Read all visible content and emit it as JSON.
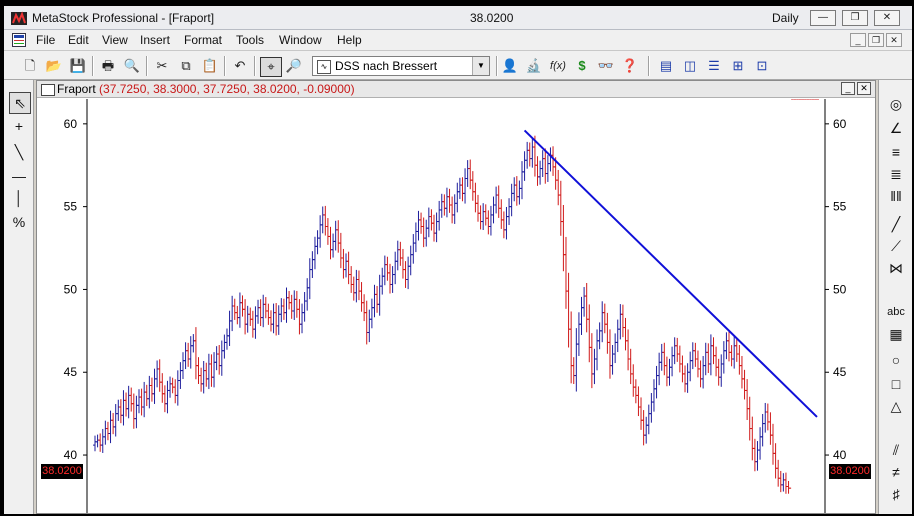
{
  "titlebar": {
    "app_title": "MetaStock Professional - [Fraport]",
    "center_value": "38.0200",
    "period": "Daily",
    "minimize": "—",
    "restore": "❐",
    "close": "✕"
  },
  "menu": {
    "items": [
      "File",
      "Edit",
      "View",
      "Insert",
      "Format",
      "Tools",
      "Window",
      "Help"
    ],
    "mdi_minimize": "_",
    "mdi_restore": "❐",
    "mdi_close": "✕"
  },
  "toolbar": {
    "indicator_selected": "DSS nach Bressert",
    "icons": {
      "new": "🗋",
      "open": "📂",
      "save": "💾",
      "print": "🖶",
      "print_preview": "🔍",
      "cut": "✂",
      "copy": "⧉",
      "paste": "📋",
      "undo": "↶",
      "crosshair": "⌖",
      "zoom": "🔎",
      "expert": "👤",
      "explorer": "🔬",
      "formula": "f(x)",
      "system": "$",
      "binoculars": "👓",
      "help": "❓",
      "win1": "▤",
      "win2": "◫",
      "win3": "☰",
      "win4": "⊞",
      "win5": "⊡"
    }
  },
  "left_tools": [
    "⇖",
    "+",
    "╲",
    "—",
    "│",
    "%"
  ],
  "right_tools": [
    "◎",
    "∠",
    "≡",
    "≣",
    "‖‖",
    "╱",
    "⟋",
    "⋈",
    "abc",
    "▦",
    "○",
    "□",
    "△",
    "⫽",
    "≠",
    "♯"
  ],
  "chart_window": {
    "caption_name": "Fraport",
    "caption_values": "(37.7250, 38.3000, 37.7250, 38.0200, -0.09000)",
    "btn_minimize": "_",
    "btn_close": "✕"
  },
  "colors": {
    "up_bar": "#1c1c9c",
    "down_bar": "#d01818",
    "trendline": "#1010d8",
    "axis_text": "#000000",
    "last_price_text": "#ff2a2a",
    "last_price_bg": "#000000"
  },
  "chart_data": {
    "type": "ohlc",
    "symbol": "Fraport",
    "y_ticks": [
      40,
      45,
      50,
      55,
      60
    ],
    "ylim": [
      36.5,
      61.5
    ],
    "last_price": "38.0200",
    "x": [
      1,
      2,
      3,
      4,
      5,
      6,
      7,
      8,
      9,
      10,
      11,
      12,
      13,
      14,
      15,
      16,
      17,
      18,
      19,
      20,
      21,
      22,
      23,
      24,
      25,
      26,
      27,
      28,
      29,
      30,
      31,
      32,
      33,
      34,
      35,
      36,
      37,
      38,
      39,
      40,
      41,
      42,
      43,
      44,
      45,
      46,
      47,
      48,
      49,
      50,
      51,
      52,
      53,
      54,
      55,
      56,
      57,
      58,
      59,
      60,
      61,
      62,
      63,
      64,
      65,
      66,
      67,
      68,
      69,
      70,
      71,
      72,
      73,
      74,
      75,
      76,
      77,
      78,
      79,
      80,
      81,
      82,
      83,
      84,
      85,
      86,
      87,
      88,
      89,
      90,
      91,
      92,
      93,
      94,
      95,
      96,
      97,
      98,
      99,
      100,
      101,
      102,
      103,
      104,
      105,
      106,
      107,
      108,
      109,
      110,
      111,
      112,
      113,
      114,
      115,
      116,
      117,
      118,
      119,
      120,
      121,
      122,
      123,
      124,
      125,
      126,
      127,
      128,
      129,
      130,
      131,
      132,
      133,
      134,
      135,
      136,
      137,
      138,
      139,
      140,
      141,
      142,
      143,
      144,
      145,
      146,
      147,
      148,
      149,
      150,
      151,
      152,
      153,
      154,
      155,
      156,
      157,
      158,
      159,
      160,
      161,
      162,
      163,
      164,
      165,
      166,
      167,
      168,
      169,
      170,
      171,
      172,
      173,
      174,
      175,
      176,
      177,
      178,
      179,
      180,
      181,
      182,
      183,
      184,
      185,
      186,
      187,
      188,
      189,
      190,
      191,
      192,
      193,
      194,
      195,
      196,
      197,
      198,
      199,
      200,
      201,
      202,
      203,
      204,
      205,
      206,
      207,
      208,
      209,
      210,
      211,
      212,
      213,
      214,
      215,
      216,
      217,
      218,
      219,
      220,
      221,
      222,
      223,
      224,
      225,
      226,
      227,
      228,
      229,
      230,
      231,
      232,
      233,
      234,
      235,
      236,
      237,
      238,
      239,
      240,
      241,
      242,
      243,
      244,
      245,
      246,
      247,
      248,
      249,
      250,
      251,
      252,
      253,
      254,
      255,
      256,
      257,
      258,
      259,
      260,
      261,
      262,
      263,
      264,
      265,
      266,
      267,
      268,
      269,
      270,
      271,
      272,
      273,
      274,
      275,
      276,
      277,
      278,
      279,
      280
    ],
    "close": [
      40.8,
      40.9,
      40.6,
      41.1,
      41.6,
      41.3,
      42.1,
      41.7,
      42.5,
      42.9,
      42.4,
      43.3,
      42.8,
      43.6,
      43.1,
      42.2,
      43.0,
      43.5,
      42.9,
      43.8,
      43.4,
      44.2,
      43.7,
      44.6,
      45.2,
      44.4,
      43.7,
      43.1,
      43.9,
      44.3,
      44.1,
      43.6,
      44.5,
      45.1,
      45.7,
      46.3,
      45.8,
      46.6,
      46.9,
      45.4,
      44.8,
      44.3,
      45.1,
      44.6,
      45.5,
      44.7,
      45.6,
      46.1,
      45.4,
      46.3,
      46.8,
      47.2,
      48.1,
      49.0,
      48.6,
      48.3,
      49.2,
      48.8,
      47.9,
      48.5,
      48.2,
      47.6,
      48.4,
      48.9,
      48.3,
      49.1,
      48.7,
      48.3,
      47.9,
      48.6,
      47.8,
      48.5,
      49.0,
      48.6,
      49.5,
      49.2,
      48.7,
      49.4,
      48.8,
      47.9,
      48.6,
      49.3,
      50.1,
      51.2,
      51.8,
      52.6,
      53.1,
      53.9,
      54.5,
      53.8,
      53.2,
      52.4,
      52.9,
      53.6,
      52.8,
      51.9,
      51.2,
      51.7,
      50.9,
      50.3,
      49.8,
      50.6,
      49.9,
      49.2,
      48.6,
      47.4,
      48.2,
      48.9,
      49.7,
      49.1,
      50.2,
      50.8,
      51.5,
      51.0,
      50.3,
      50.9,
      51.7,
      52.4,
      51.9,
      51.2,
      50.6,
      51.4,
      52.1,
      52.8,
      53.5,
      54.2,
      53.8,
      53.1,
      53.7,
      54.4,
      54.0,
      53.4,
      54.1,
      54.8,
      55.3,
      54.9,
      55.6,
      55.1,
      54.5,
      55.2,
      55.9,
      56.3,
      55.8,
      56.7,
      57.3,
      56.6,
      55.9,
      55.2,
      54.6,
      54.1,
      54.7,
      54.3,
      53.8,
      54.5,
      55.1,
      55.7,
      54.9,
      54.2,
      53.6,
      54.4,
      55.0,
      55.8,
      56.3,
      55.6,
      56.1,
      57.1,
      57.8,
      58.4,
      57.9,
      58.6,
      57.5,
      56.8,
      57.3,
      57.9,
      57.0,
      57.6,
      58.1,
      57.4,
      56.6,
      55.7,
      54.1,
      52.1,
      49.9,
      47.6,
      45.4,
      44.8,
      46.7,
      47.9,
      48.9,
      49.6,
      48.2,
      46.5,
      44.9,
      45.8,
      46.9,
      47.5,
      48.6,
      47.9,
      46.8,
      45.4,
      46.1,
      46.8,
      47.6,
      48.5,
      47.7,
      46.9,
      45.8,
      44.9,
      44.1,
      43.6,
      42.9,
      42.1,
      41.2,
      41.8,
      42.5,
      43.2,
      44.0,
      44.8,
      45.6,
      46.2,
      45.4,
      44.7,
      45.3,
      46.0,
      46.6,
      46.1,
      45.5,
      44.9,
      44.3,
      45.0,
      45.7,
      46.3,
      45.8,
      45.2,
      44.6,
      45.4,
      46.2,
      45.5,
      46.6,
      46.0,
      45.3,
      44.7,
      45.5,
      46.3,
      46.9,
      46.2,
      45.8,
      46.6,
      46.1,
      45.4,
      44.6,
      43.9,
      42.8,
      41.6,
      40.4,
      39.6,
      40.3,
      41.1,
      41.9,
      42.6,
      42.0,
      41.2,
      40.1,
      39.2,
      38.6,
      38.2,
      38.5,
      38.1,
      38.0
    ],
    "trendline": {
      "x1": 167,
      "y1": 59.6,
      "x2": 280,
      "y2": 42.3
    }
  }
}
